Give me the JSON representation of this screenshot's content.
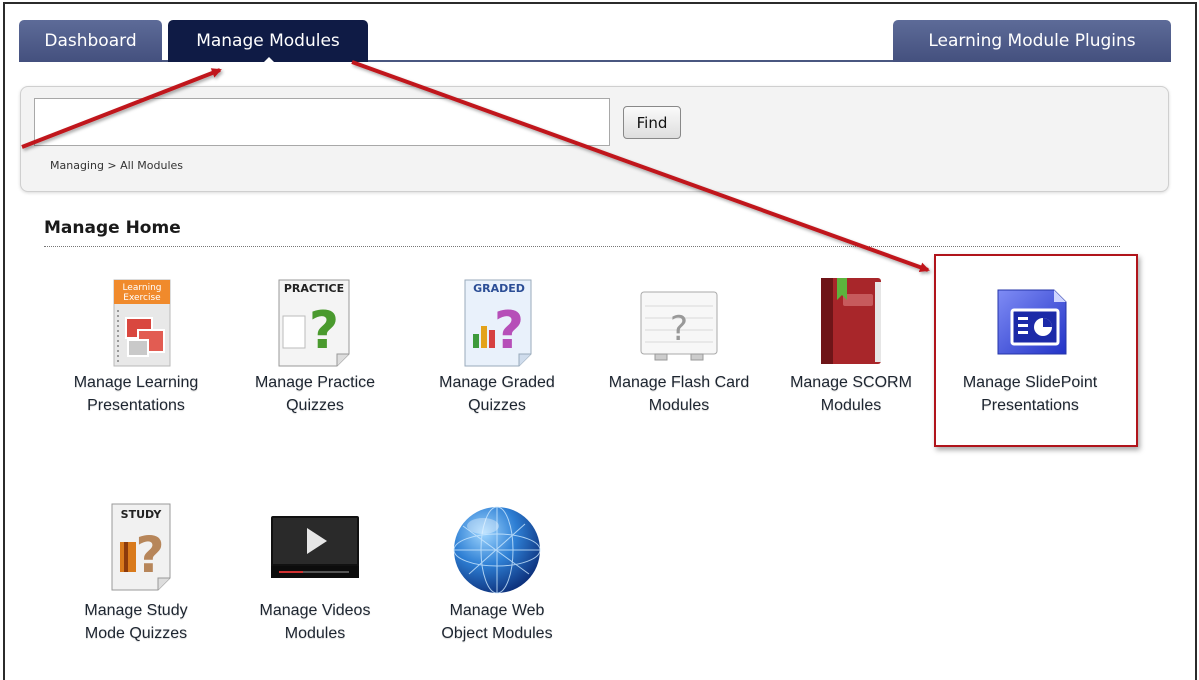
{
  "tabs": {
    "dashboard": "Dashboard",
    "manage_modules": "Manage Modules",
    "plugins": "Learning Module Plugins"
  },
  "search": {
    "value": "",
    "placeholder": "",
    "find_label": "Find",
    "breadcrumb": "Managing > All Modules"
  },
  "section": {
    "title": "Manage Home"
  },
  "modules": {
    "learning": {
      "line1": "Manage Learning",
      "line2": "Presentations",
      "icon": "learning-exercise-icon",
      "badge1": "Learning",
      "badge2": "Exercise"
    },
    "practice": {
      "line1": "Manage Practice",
      "line2": "Quizzes",
      "icon": "practice-quiz-icon",
      "badge": "PRACTICE"
    },
    "graded": {
      "line1": "Manage Graded",
      "line2": "Quizzes",
      "icon": "graded-quiz-icon",
      "badge": "GRADED"
    },
    "flashcard": {
      "line1": "Manage Flash Card",
      "line2": "Modules",
      "icon": "flash-card-icon",
      "glyph": "?"
    },
    "scorm": {
      "line1": "Manage SCORM",
      "line2": "Modules",
      "icon": "scorm-book-icon"
    },
    "slidepoint": {
      "line1": "Manage SlidePoint",
      "line2": "Presentations",
      "icon": "slidepoint-icon"
    },
    "study": {
      "line1": "Manage Study",
      "line2": "Mode Quizzes",
      "icon": "study-quiz-icon",
      "badge": "STUDY"
    },
    "videos": {
      "line1": "Manage Videos",
      "line2": "Modules",
      "icon": "video-player-icon"
    },
    "webobject": {
      "line1": "Manage Web",
      "line2": "Object Modules",
      "icon": "globe-icon"
    }
  },
  "colors": {
    "tab_inactive": "#4f5c8a",
    "tab_active": "#0f1b45",
    "annotation_red": "#b0141b"
  }
}
